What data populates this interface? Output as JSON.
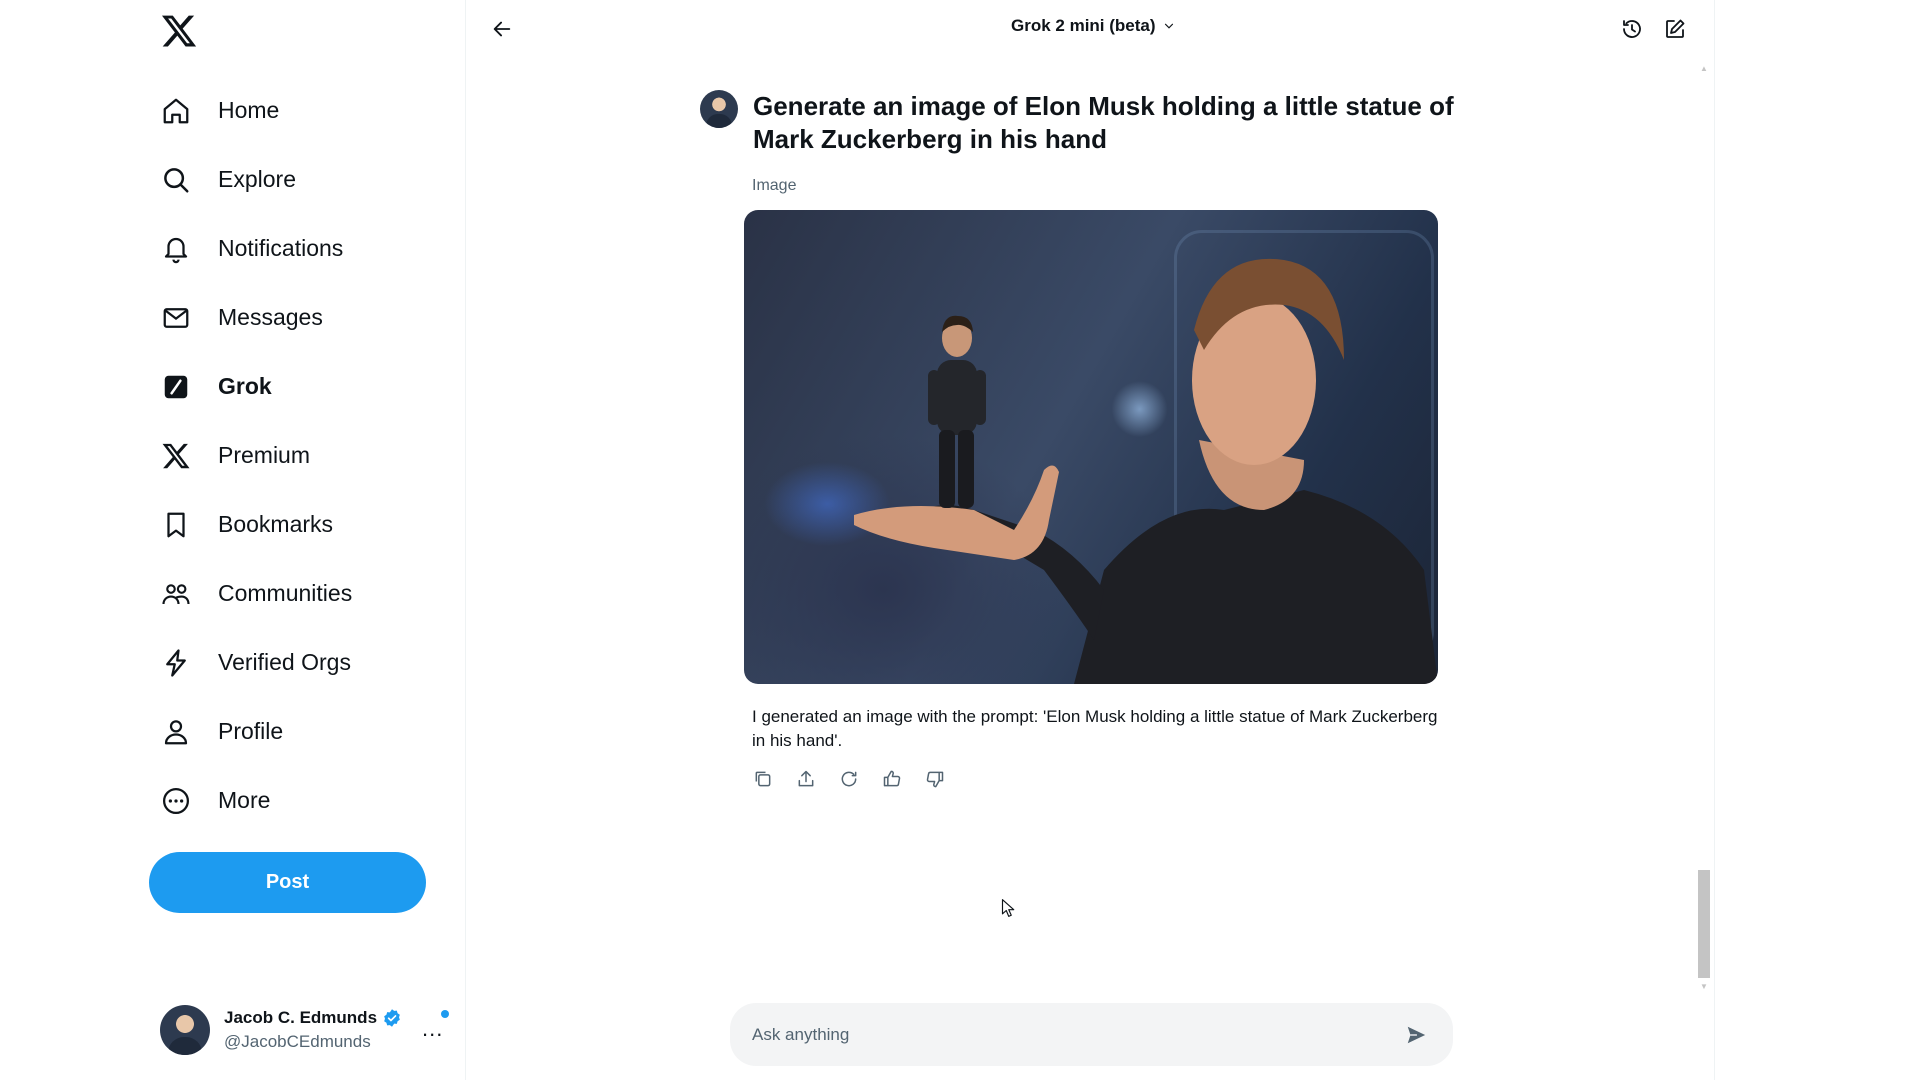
{
  "sidebar": {
    "logo_icon": "x-logo-icon",
    "items": [
      {
        "label": "Home",
        "icon": "home-icon"
      },
      {
        "label": "Explore",
        "icon": "search-icon"
      },
      {
        "label": "Notifications",
        "icon": "bell-icon"
      },
      {
        "label": "Messages",
        "icon": "envelope-icon"
      },
      {
        "label": "Grok",
        "icon": "grok-icon",
        "active": true
      },
      {
        "label": "Premium",
        "icon": "x-icon"
      },
      {
        "label": "Bookmarks",
        "icon": "bookmark-icon"
      },
      {
        "label": "Communities",
        "icon": "people-icon"
      },
      {
        "label": "Verified Orgs",
        "icon": "lightning-icon"
      },
      {
        "label": "Profile",
        "icon": "person-icon"
      },
      {
        "label": "More",
        "icon": "more-circle-icon"
      }
    ],
    "post_label": "Post",
    "account": {
      "name": "Jacob C. Edmunds",
      "handle": "@JacobCEdmunds",
      "more_label": "..."
    }
  },
  "header": {
    "model_label": "Grok 2 mini (beta)"
  },
  "conversation": {
    "prompt": "Generate an image of Elon Musk holding a little statue of Mark Zuckerberg in his hand",
    "image_label": "Image",
    "answer": "I generated an image with the prompt: 'Elon Musk holding a little statue of Mark Zuckerberg in his hand'."
  },
  "composer": {
    "placeholder": "Ask anything"
  },
  "colors": {
    "accent": "#1d9bf0",
    "text": "#0f1419",
    "muted": "#536471",
    "composer_bg": "#f3f4f5"
  }
}
